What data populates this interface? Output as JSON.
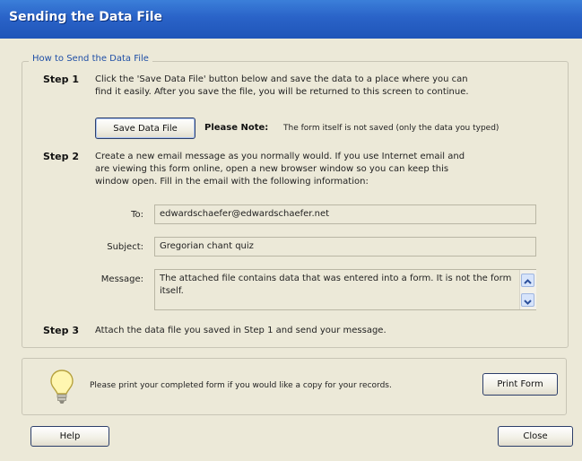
{
  "window": {
    "title": "Sending the Data File"
  },
  "group": {
    "legend": "How to Send the Data File"
  },
  "step1": {
    "label": "Step 1",
    "line1": "Click the 'Save Data File' button below and save the data to a place where you can",
    "line2": "find it easily. After you save the file, you will be returned to this screen to continue.",
    "save_button": "Save Data File",
    "note_label": "Please Note:",
    "note_text": "The form itself is not saved (only the data you typed)"
  },
  "step2": {
    "label": "Step 2",
    "line1": "Create a new email message as you normally would.  If you use Internet email and",
    "line2": "are viewing this form online, open a new browser window so you can keep this",
    "line3": "window open. Fill in the email with the following information:",
    "to_label": "To:",
    "to_value": "edwardschaefer@edwardschaefer.net",
    "subject_label": "Subject:",
    "subject_value": "Gregorian chant quiz",
    "message_label": "Message:",
    "message_value": "The attached file contains data that was entered into a form. It is not the form itself."
  },
  "step3": {
    "label": "Step 3",
    "text": "Attach the data file you saved in Step 1 and send your message."
  },
  "print": {
    "text": "Please print your completed form if you would like a copy for your records.",
    "button": "Print Form"
  },
  "footer": {
    "help": "Help",
    "close": "Close"
  },
  "colors": {
    "title_bar": "#2a63c8",
    "dialog_bg": "#ece9d8",
    "legend_text": "#1f4fa6"
  },
  "icons": {
    "tip": "lightbulb-icon",
    "scroll_up": "scroll-up-arrow-icon",
    "scroll_down": "scroll-down-arrow-icon"
  }
}
